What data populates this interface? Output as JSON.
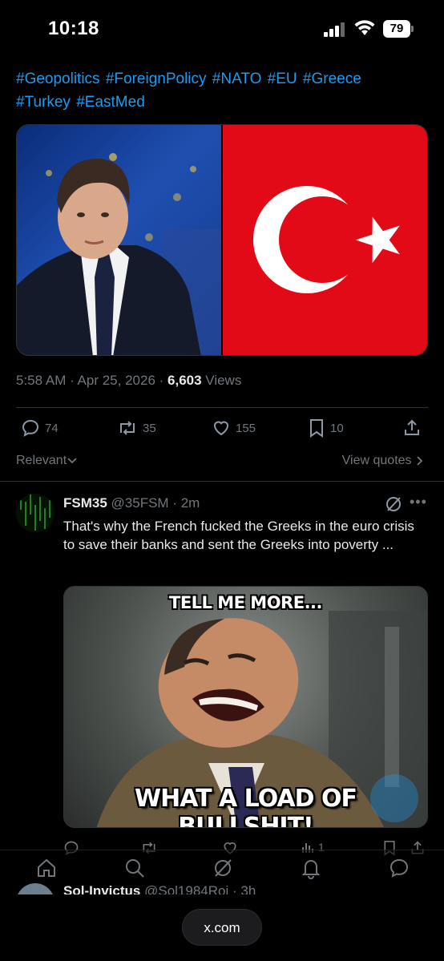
{
  "status_bar": {
    "time": "10:18",
    "battery": "79"
  },
  "post": {
    "hashtags": [
      "#Geopolitics",
      "#ForeignPolicy",
      "#NATO",
      "#EU",
      "#Greece",
      "#Turkey",
      "#EastMed"
    ],
    "timestamp": "5:58 AM · Apr 25, 2026 · ",
    "views_count": "6,603",
    "views_label": " Views",
    "actions": {
      "replies": "74",
      "reposts": "35",
      "likes": "155",
      "bookmarks": "10"
    },
    "sort_label": "Relevant",
    "view_quotes_label": "View quotes"
  },
  "reply": {
    "name": "FSM35",
    "handle": "@35FSM",
    "age": "· 2m",
    "text": "That's why the French fucked the Greeks in the euro crisis to save their banks and sent the Greeks into poverty ...",
    "meme_top": "TELL ME MORE...",
    "meme_bottom": "WHAT A LOAD OF BULLSHIT!",
    "actions": {
      "views": "1"
    }
  },
  "next_reply": {
    "name": "Sol-Invictus",
    "handle": "@Sol1984Roi",
    "age": "· 3h"
  },
  "browser": {
    "url": "x.com"
  },
  "colors": {
    "link": "#1d9bf0",
    "muted": "#71767b",
    "flag_red": "#e30a17"
  }
}
